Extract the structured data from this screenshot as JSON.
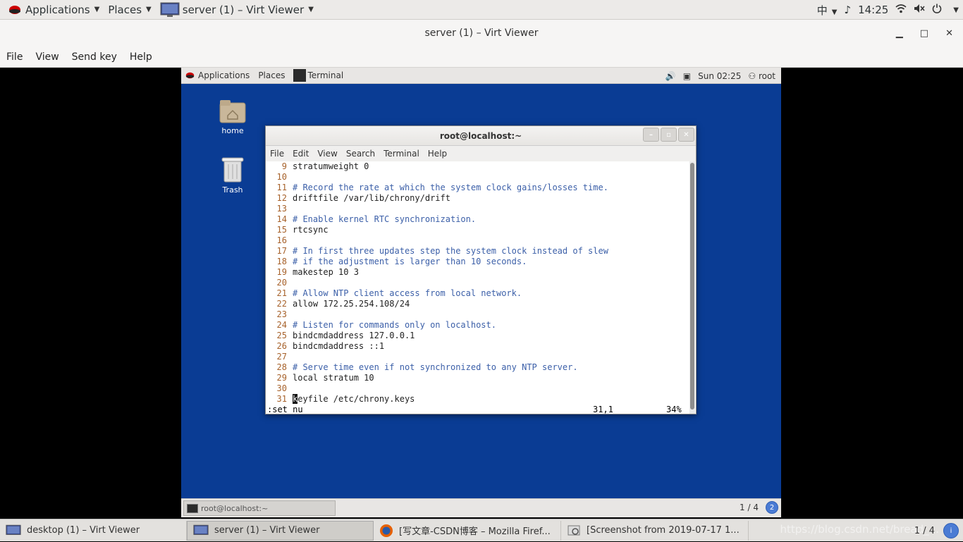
{
  "host_panel": {
    "applications": "Applications",
    "places": "Places",
    "window": "server (1) – Virt Viewer",
    "input_method": "中",
    "time": "14:25"
  },
  "viewer": {
    "title": "server (1) – Virt Viewer",
    "menu": [
      "File",
      "View",
      "Send key",
      "Help"
    ]
  },
  "guest_panel": {
    "applications": "Applications",
    "places": "Places",
    "terminal": "Terminal",
    "datetime": "Sun 02:25",
    "user": "root"
  },
  "desktop": {
    "home": "home",
    "trash": "Trash"
  },
  "terminal": {
    "title": "root@localhost:~",
    "menu": [
      "File",
      "Edit",
      "View",
      "Search",
      "Terminal",
      "Help"
    ],
    "lines": [
      {
        "n": "9",
        "t": "stratumweight 0",
        "c": false
      },
      {
        "n": "10",
        "t": "",
        "c": false
      },
      {
        "n": "11",
        "t": "# Record the rate at which the system clock gains/losses time.",
        "c": true
      },
      {
        "n": "12",
        "t": "driftfile /var/lib/chrony/drift",
        "c": false
      },
      {
        "n": "13",
        "t": "",
        "c": false
      },
      {
        "n": "14",
        "t": "# Enable kernel RTC synchronization.",
        "c": true
      },
      {
        "n": "15",
        "t": "rtcsync",
        "c": false
      },
      {
        "n": "16",
        "t": "",
        "c": false
      },
      {
        "n": "17",
        "t": "# In first three updates step the system clock instead of slew",
        "c": true
      },
      {
        "n": "18",
        "t": "# if the adjustment is larger than 10 seconds.",
        "c": true
      },
      {
        "n": "19",
        "t": "makestep 10 3",
        "c": false
      },
      {
        "n": "20",
        "t": "",
        "c": false
      },
      {
        "n": "21",
        "t": "# Allow NTP client access from local network.",
        "c": true
      },
      {
        "n": "22",
        "t": "allow 172.25.254.108/24",
        "c": false
      },
      {
        "n": "23",
        "t": "",
        "c": false
      },
      {
        "n": "24",
        "t": "# Listen for commands only on localhost.",
        "c": true
      },
      {
        "n": "25",
        "t": "bindcmdaddress 127.0.0.1",
        "c": false
      },
      {
        "n": "26",
        "t": "bindcmdaddress ::1",
        "c": false
      },
      {
        "n": "27",
        "t": "",
        "c": false
      },
      {
        "n": "28",
        "t": "# Serve time even if not synchronized to any NTP server.",
        "c": true
      },
      {
        "n": "29",
        "t": "local stratum 10",
        "c": false
      },
      {
        "n": "30",
        "t": "",
        "c": false
      },
      {
        "n": "31",
        "t": "keyfile /etc/chrony.keys",
        "c": false
      }
    ],
    "status_cmd": ":set nu",
    "status_pos": "31,1",
    "status_pct": "34%"
  },
  "guest_bottom": {
    "task": "root@localhost:~",
    "workspace": "1 / 4",
    "badge": "2"
  },
  "host_taskbar": {
    "tasks": [
      "desktop (1) – Virt Viewer",
      "server (1) – Virt Viewer",
      "[写文章-CSDN博客 – Mozilla Firef...",
      "[Screenshot from 2019-07-17 1..."
    ],
    "workspace": "1 / 4",
    "watermark": "https://blog.csdn.net/bread_..."
  }
}
